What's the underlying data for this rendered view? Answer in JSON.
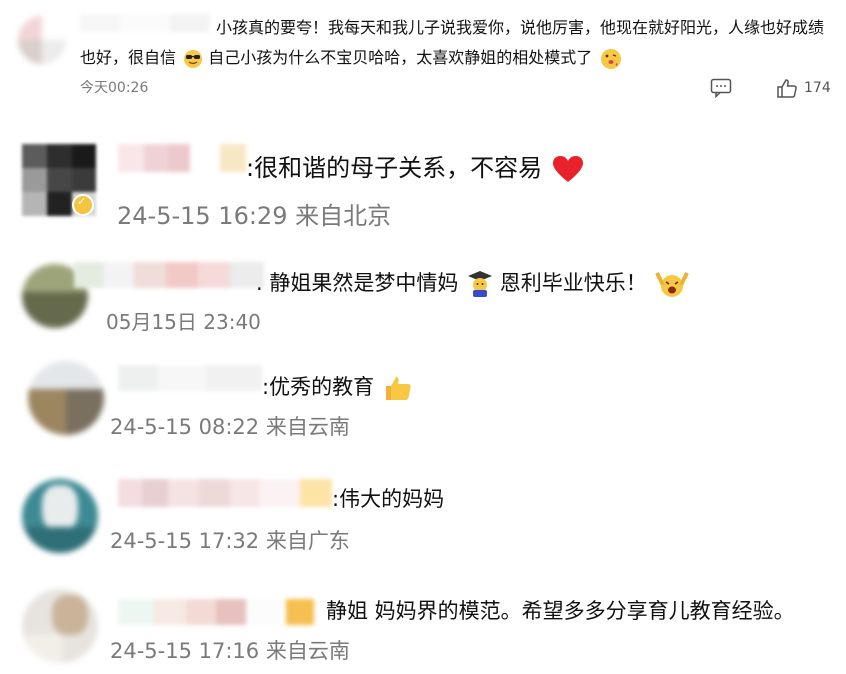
{
  "comments": [
    {
      "text_line1": "小孩真的要夸！我每天和我儿子说我爱你，说他厉害，他现在就好阳光，人缘也好成绩",
      "text_line2a": "也好，很自信",
      "text_line2b": "自己小孩为什么不宝贝哈哈，太喜欢静姐的相处模式了",
      "time": "今天00:26",
      "like_count": "174",
      "icons": [
        "sunglasses-emoji",
        "blowing-kiss-emoji",
        "comment-icon",
        "thumbs-up-icon"
      ]
    },
    {
      "text": ":很和谐的母子关系，不容易",
      "time": "24-5-15 16:29 来自北京",
      "icons": [
        "red-heart-emoji",
        "verified-badge"
      ]
    },
    {
      "text_a": ". 静姐果然是梦中情妈",
      "text_b": "恩利毕业快乐！",
      "time": "05月15日 23:40",
      "icons": [
        "graduate-emoji",
        "cheering-emoji"
      ]
    },
    {
      "text": ":优秀的教育",
      "time": "24-5-15 08:22 来自云南",
      "icons": [
        "thumbs-up-emoji"
      ]
    },
    {
      "text": ":伟大的妈妈",
      "time": "24-5-15 17:32 来自广东"
    },
    {
      "text": "静姐 妈妈界的模范。希望多多分享育儿教育经验。",
      "time": "24-5-15 17:16 来自云南"
    }
  ]
}
